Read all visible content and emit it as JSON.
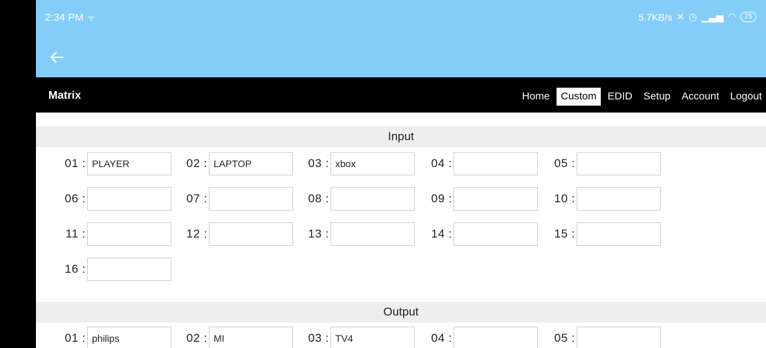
{
  "status_bar": {
    "time": "2:34 PM",
    "speed": "5.7KB/s",
    "battery": "75"
  },
  "nav": {
    "brand": "Matrix",
    "links": [
      "Home",
      "Custom",
      "EDID",
      "Setup",
      "Account",
      "Logout"
    ],
    "active": "Custom"
  },
  "input": {
    "title": "Input",
    "fields": [
      {
        "label": "01 :",
        "value": "PLAYER"
      },
      {
        "label": "02 :",
        "value": "LAPTOP"
      },
      {
        "label": "03 :",
        "value": "xbox"
      },
      {
        "label": "04 :",
        "value": ""
      },
      {
        "label": "05 :",
        "value": ""
      },
      {
        "label": "06 :",
        "value": ""
      },
      {
        "label": "07 :",
        "value": ""
      },
      {
        "label": "08 :",
        "value": ""
      },
      {
        "label": "09 :",
        "value": ""
      },
      {
        "label": "10 :",
        "value": ""
      },
      {
        "label": "11 :",
        "value": ""
      },
      {
        "label": "12 :",
        "value": ""
      },
      {
        "label": "13 :",
        "value": ""
      },
      {
        "label": "14 :",
        "value": ""
      },
      {
        "label": "15 :",
        "value": ""
      },
      {
        "label": "16 :",
        "value": ""
      }
    ]
  },
  "output": {
    "title": "Output",
    "fields": [
      {
        "label": "01 :",
        "value": "philips"
      },
      {
        "label": "02 :",
        "value": "MI"
      },
      {
        "label": "03 :",
        "value": "TV4"
      },
      {
        "label": "04 :",
        "value": ""
      },
      {
        "label": "05 :",
        "value": ""
      }
    ]
  },
  "colors": {
    "status_bar": "#85cdf9",
    "nav_bar": "#000000",
    "section_header": "#eeeeee"
  },
  "icons": [
    "wifi-icon",
    "mute-icon",
    "alarm-icon",
    "signal-icon",
    "battery-icon",
    "back-arrow-icon"
  ]
}
